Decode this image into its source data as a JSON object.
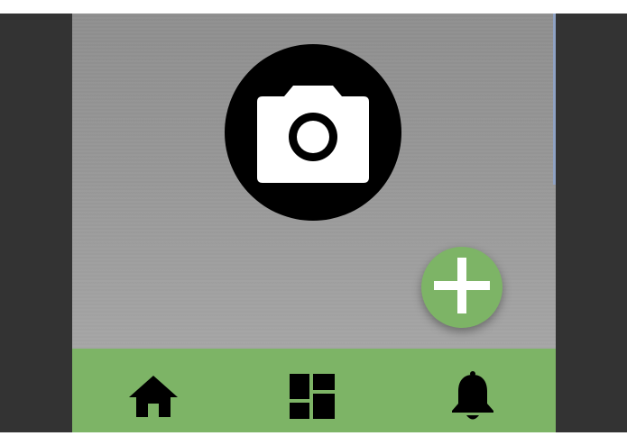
{
  "screen": {
    "camera_button": {
      "icon": "camera-icon",
      "background": "#000000",
      "icon_color": "#ffffff"
    },
    "fab": {
      "icon": "plus-icon",
      "background": "#7db466",
      "icon_color": "#ffffff"
    }
  },
  "bottom_nav": {
    "background": "#7db466",
    "items": [
      {
        "icon": "home-icon"
      },
      {
        "icon": "dashboard-icon"
      },
      {
        "icon": "bell-icon"
      }
    ]
  },
  "colors": {
    "frame": "#333333",
    "content_background": "#999999",
    "accent": "#7db466"
  }
}
